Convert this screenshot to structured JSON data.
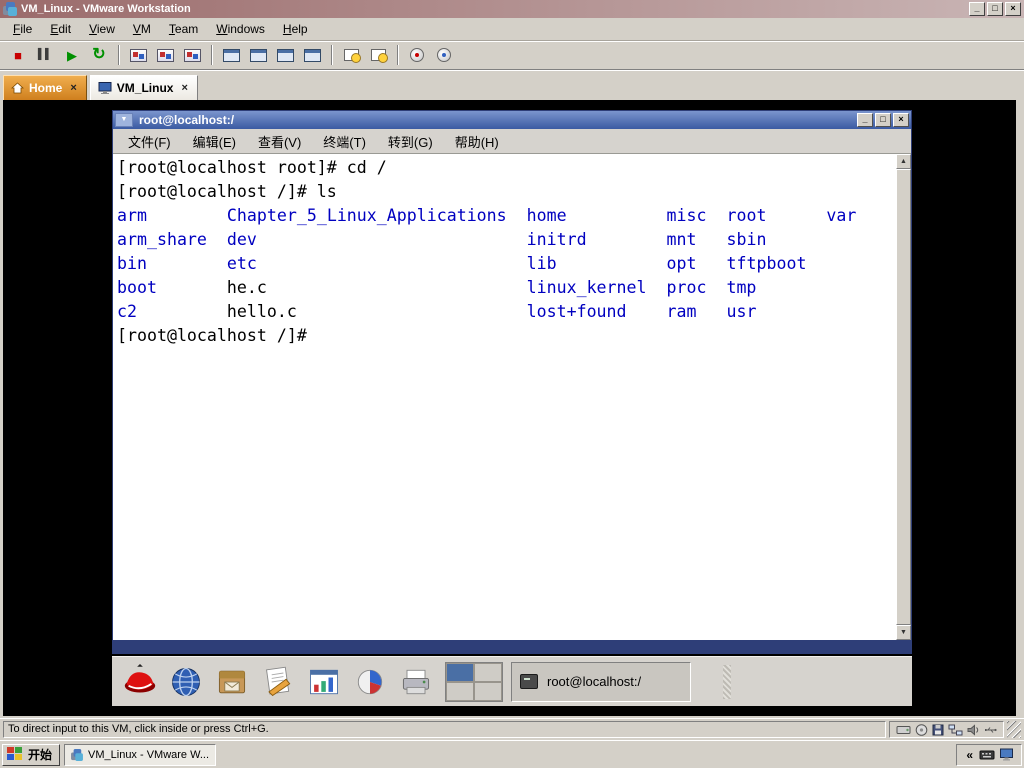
{
  "window": {
    "title": "VM_Linux - VMware Workstation",
    "controls": {
      "minimize": "_",
      "maximize": "□",
      "close": "×"
    }
  },
  "menubar": {
    "items": [
      "File",
      "Edit",
      "View",
      "VM",
      "Team",
      "Windows",
      "Help"
    ]
  },
  "toolbar": {
    "buttons": [
      {
        "name": "power-off",
        "glyph": "■",
        "group": 1
      },
      {
        "name": "suspend",
        "glyph": "▌▌",
        "group": 1
      },
      {
        "name": "power-on",
        "glyph": "▶",
        "group": 1
      },
      {
        "name": "reset",
        "glyph": "↻",
        "group": 1
      },
      {
        "name": "snapshot-take",
        "glyph": "",
        "group": 2
      },
      {
        "name": "snapshot-revert",
        "glyph": "",
        "group": 2
      },
      {
        "name": "snapshot-manager",
        "glyph": "",
        "group": 2
      },
      {
        "name": "fullscreen",
        "glyph": "",
        "group": 3
      },
      {
        "name": "quick-switch",
        "glyph": "",
        "group": 3
      },
      {
        "name": "summary-view",
        "glyph": "",
        "group": 3
      },
      {
        "name": "console-view",
        "glyph": "",
        "group": 3
      },
      {
        "name": "capture-screen",
        "glyph": "",
        "group": 4
      },
      {
        "name": "capture-movie",
        "glyph": "",
        "group": 4
      },
      {
        "name": "install-tools",
        "glyph": "",
        "group": 5
      },
      {
        "name": "help",
        "glyph": "",
        "group": 5
      }
    ]
  },
  "tabs": {
    "home": "Home",
    "vm": "VM_Linux",
    "close_glyph": "×"
  },
  "terminal": {
    "title": "root@localhost:/",
    "window_menu_glyph": "▼",
    "menu": [
      "文件(F)",
      "编辑(E)",
      "查看(V)",
      "终端(T)",
      "转到(G)",
      "帮助(H)"
    ],
    "scrollbar": {
      "up": "▲",
      "down": "▼"
    },
    "lines": [
      {
        "segs": [
          {
            "t": "[root@localhost root]# cd /",
            "c": "p",
            "col": 0
          }
        ]
      },
      {
        "segs": [
          {
            "t": "[root@localhost /]# ls",
            "c": "p",
            "col": 0
          }
        ]
      },
      {
        "segs": [
          {
            "t": "arm",
            "c": "d",
            "col": 0
          },
          {
            "t": "Chapter_5_Linux_Applications",
            "c": "d",
            "col": 11
          },
          {
            "t": "home",
            "c": "d",
            "col": 41
          },
          {
            "t": "misc",
            "c": "d",
            "col": 55
          },
          {
            "t": "root",
            "c": "d",
            "col": 61
          },
          {
            "t": "var",
            "c": "d",
            "col": 71
          }
        ]
      },
      {
        "segs": [
          {
            "t": "arm_share",
            "c": "d",
            "col": 0
          },
          {
            "t": "dev",
            "c": "d",
            "col": 11
          },
          {
            "t": "initrd",
            "c": "d",
            "col": 41
          },
          {
            "t": "mnt",
            "c": "d",
            "col": 55
          },
          {
            "t": "sbin",
            "c": "d",
            "col": 61
          }
        ]
      },
      {
        "segs": [
          {
            "t": "bin",
            "c": "d",
            "col": 0
          },
          {
            "t": "etc",
            "c": "d",
            "col": 11
          },
          {
            "t": "lib",
            "c": "d",
            "col": 41
          },
          {
            "t": "opt",
            "c": "d",
            "col": 55
          },
          {
            "t": "tftpboot",
            "c": "d",
            "col": 61
          }
        ]
      },
      {
        "segs": [
          {
            "t": "boot",
            "c": "d",
            "col": 0
          },
          {
            "t": "he.c",
            "c": "f",
            "col": 11
          },
          {
            "t": "linux_kernel",
            "c": "d",
            "col": 41
          },
          {
            "t": "proc",
            "c": "d",
            "col": 55
          },
          {
            "t": "tmp",
            "c": "d",
            "col": 61
          }
        ]
      },
      {
        "segs": [
          {
            "t": "c2",
            "c": "d",
            "col": 0
          },
          {
            "t": "hello.c",
            "c": "f",
            "col": 11
          },
          {
            "t": "lost+found",
            "c": "d",
            "col": 41
          },
          {
            "t": "ram",
            "c": "d",
            "col": 55
          },
          {
            "t": "usr",
            "c": "d",
            "col": 61
          }
        ]
      },
      {
        "segs": [
          {
            "t": "[root@localhost /]# ",
            "c": "p",
            "col": 0
          }
        ]
      }
    ]
  },
  "panel": {
    "launchers": [
      "redhat-menu",
      "web-browser",
      "evolution-mail",
      "writer",
      "calc",
      "impress",
      "printer"
    ],
    "workspace_count": 4,
    "window_button": "root@localhost:/"
  },
  "statusbar": {
    "message": "To direct input to this VM, click inside or press Ctrl+G.",
    "devices": [
      "harddisk",
      "cdrom",
      "floppy",
      "ethernet",
      "sound",
      "usb"
    ]
  },
  "taskbar": {
    "start": "开始",
    "task": "VM_Linux - VMware W...",
    "collapse": "«"
  }
}
